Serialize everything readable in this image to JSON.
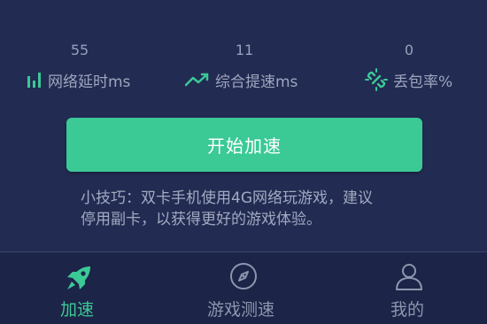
{
  "stats": [
    {
      "value": "55",
      "label": "网络延时ms",
      "icon": "signal-bars-icon"
    },
    {
      "value": "11",
      "label": "综合提速ms",
      "icon": "trend-up-icon"
    },
    {
      "value": "0",
      "label": "丢包率%",
      "icon": "broken-link-icon"
    }
  ],
  "start_button": {
    "label": "开始加速"
  },
  "tip": {
    "line1": "小技巧：双卡手机使用4G网络玩游戏，建议",
    "line2": "停用副卡，以获得更好的游戏体验。"
  },
  "tabs": [
    {
      "label": "加速",
      "icon": "rocket-icon",
      "active": true
    },
    {
      "label": "游戏测速",
      "icon": "compass-icon",
      "active": false
    },
    {
      "label": "我的",
      "icon": "person-icon",
      "active": false
    }
  ],
  "colors": {
    "background": "#222b52",
    "accent": "#3bc996",
    "stat_text": "#9ea6bd",
    "tab_inactive": "#8e96ae",
    "tab_bar": "#1c2447"
  }
}
